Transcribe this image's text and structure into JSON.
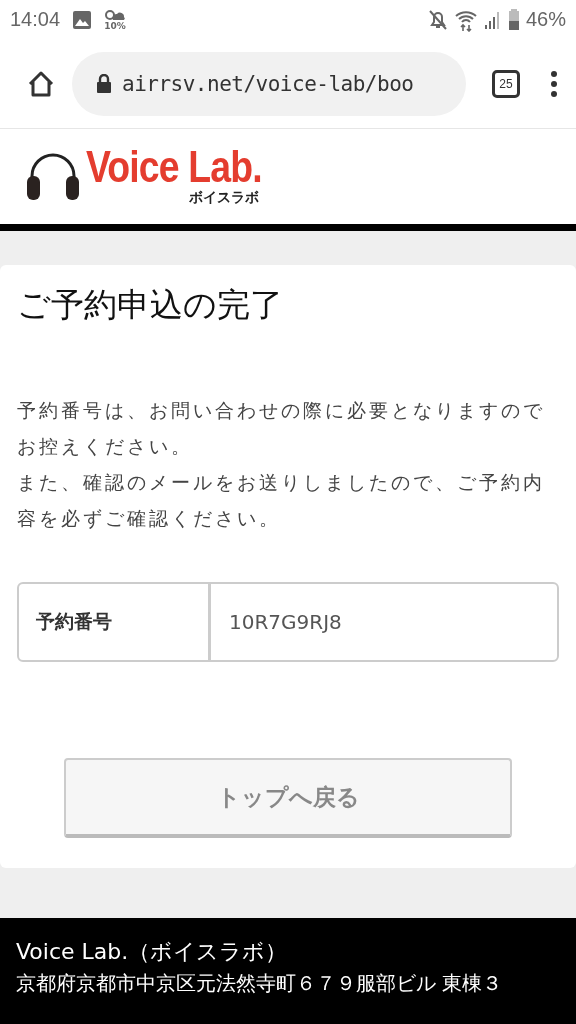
{
  "status_bar": {
    "time": "14:04",
    "weather": "10%",
    "battery": "46%"
  },
  "browser": {
    "url": "airrsv.net/voice-lab/boo",
    "tab_count": "25"
  },
  "logo": {
    "name": "Voice Lab.",
    "kana": "ボイスラボ"
  },
  "page": {
    "title": "ご予約申込の完了",
    "message": [
      "予約番号は、お問い合わせの際に必要となりますのでお控えください。",
      "また、確認のメールをお送りしましたので、ご予約内容を必ずご確認ください。"
    ],
    "reservation": {
      "label": "予約番号",
      "value": "10R7G9RJ8"
    },
    "button": "トップへ戻る"
  },
  "footer": {
    "name": "Voice Lab.（ボイスラボ）",
    "address": "京都府京都市中京区元法然寺町６７９服部ビル 東棟３"
  }
}
